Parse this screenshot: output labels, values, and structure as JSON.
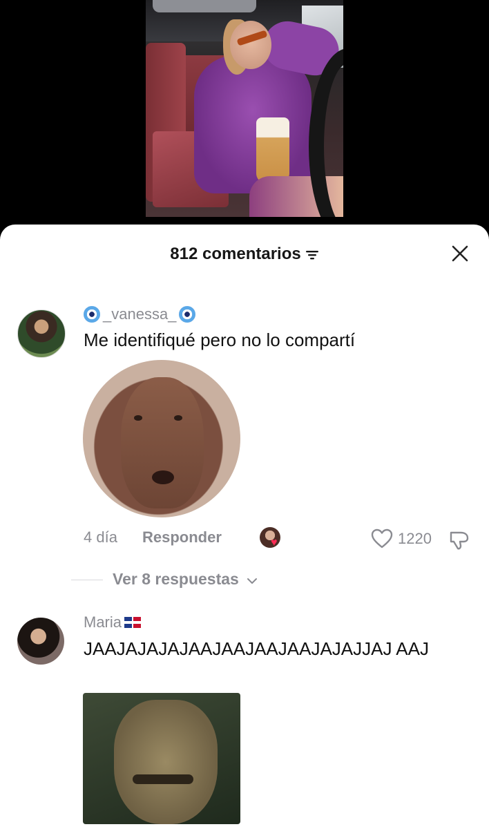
{
  "video": {
    "description_icon": "video-frame"
  },
  "comments_header": {
    "count_label": "812 comentarios"
  },
  "comments": [
    {
      "username": "_vanessa_",
      "text": "Me identifiqué pero no lo compartí",
      "time": "4 día",
      "reply_label": "Responder",
      "likes": "1220",
      "replies_label": "Ver 8 respuestas"
    },
    {
      "username": "Maria",
      "text": "JAAJAJAJAJAAJAAJAAJAAJAJAJJAJ AAJ"
    }
  ],
  "colors": {
    "accent_heart": "#fe2c55",
    "muted_text": "#8a8b91"
  }
}
